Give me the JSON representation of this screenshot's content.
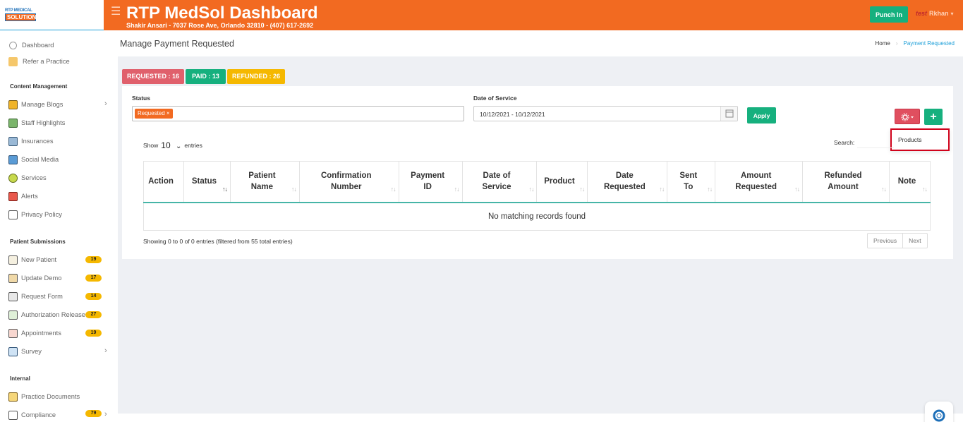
{
  "brand": {
    "logo_top": "RTP MEDICAL",
    "logo_bottom": "SOLUTION"
  },
  "header": {
    "title": "RTP MedSol Dashboard",
    "subtitle": "Shakir Ansari - 7037 Rose Ave, Orlando 32810 - (407) 617-2692",
    "punch_label": "Punch In",
    "avatar_text": "test",
    "user_name": "Rkhan"
  },
  "sidebar": {
    "top_items": [
      {
        "label": "Dashboard",
        "icon": "dashboard-icon"
      },
      {
        "label": "Refer a Practice",
        "icon": "refer-icon"
      }
    ],
    "content_heading": "Content Management",
    "content_items": [
      {
        "label": "Manage Blogs",
        "icon": "blogs-icon"
      },
      {
        "label": "Staff Highlights",
        "icon": "staff-icon"
      },
      {
        "label": "Insurances",
        "icon": "insurances-icon"
      },
      {
        "label": "Social Media",
        "icon": "social-media-icon"
      },
      {
        "label": "Services",
        "icon": "services-icon"
      },
      {
        "label": "Alerts",
        "icon": "alerts-icon"
      },
      {
        "label": "Privacy Policy",
        "icon": "privacy-icon"
      }
    ],
    "patient_heading": "Patient Submissions",
    "patient_items": [
      {
        "label": "New Patient",
        "badge": "19"
      },
      {
        "label": "Update Demo",
        "badge": "17"
      },
      {
        "label": "Request Form",
        "badge": "14"
      },
      {
        "label": "Authorization Release",
        "badge": "27"
      },
      {
        "label": "Appointments",
        "badge": "19"
      },
      {
        "label": "Survey",
        "badge": ""
      }
    ],
    "internal_heading": "Internal",
    "internal_items": [
      {
        "label": "Practice Documents",
        "badge": ""
      },
      {
        "label": "Compliance",
        "badge": "79"
      }
    ]
  },
  "page": {
    "title": "Manage Payment Requested",
    "breadcrumb": {
      "home": "Home",
      "current": "Payment Requested"
    }
  },
  "tabs": {
    "requested": "REQUESTED : 16",
    "paid": "PAID : 13",
    "refunded": "REFUNDED : 26"
  },
  "colors": {
    "requested": "#e0606c",
    "paid": "#16b07e",
    "refunded": "#f5b800",
    "accent": "#f26a21"
  },
  "filters": {
    "status_label": "Status",
    "status_chip": "Requested ×",
    "date_label": "Date of Service",
    "date_value": "10/12/2021 - 10/12/2021",
    "apply_label": "Apply"
  },
  "actions": {
    "plus_label": "+",
    "dropdown_item": "Products"
  },
  "table": {
    "show_label": "Show",
    "show_value": "10",
    "entries_label": "entries",
    "search_label": "Search:",
    "columns": [
      {
        "line1": "Action",
        "line2": ""
      },
      {
        "line1": "Status",
        "line2": ""
      },
      {
        "line1": "Patient",
        "line2": "Name"
      },
      {
        "line1": "Confirmation",
        "line2": "Number"
      },
      {
        "line1": "Payment",
        "line2": "ID"
      },
      {
        "line1": "Date of",
        "line2": "Service"
      },
      {
        "line1": "Product",
        "line2": ""
      },
      {
        "line1": "Date",
        "line2": "Requested"
      },
      {
        "line1": "Sent",
        "line2": "To"
      },
      {
        "line1": "Amount",
        "line2": "Requested"
      },
      {
        "line1": "Refunded",
        "line2": "Amount"
      },
      {
        "line1": "Note",
        "line2": ""
      }
    ],
    "empty_message": "No matching records found",
    "info": "Showing 0 to 0 of 0 entries (filtered from 55 total entries)",
    "prev_label": "Previous",
    "next_label": "Next"
  }
}
